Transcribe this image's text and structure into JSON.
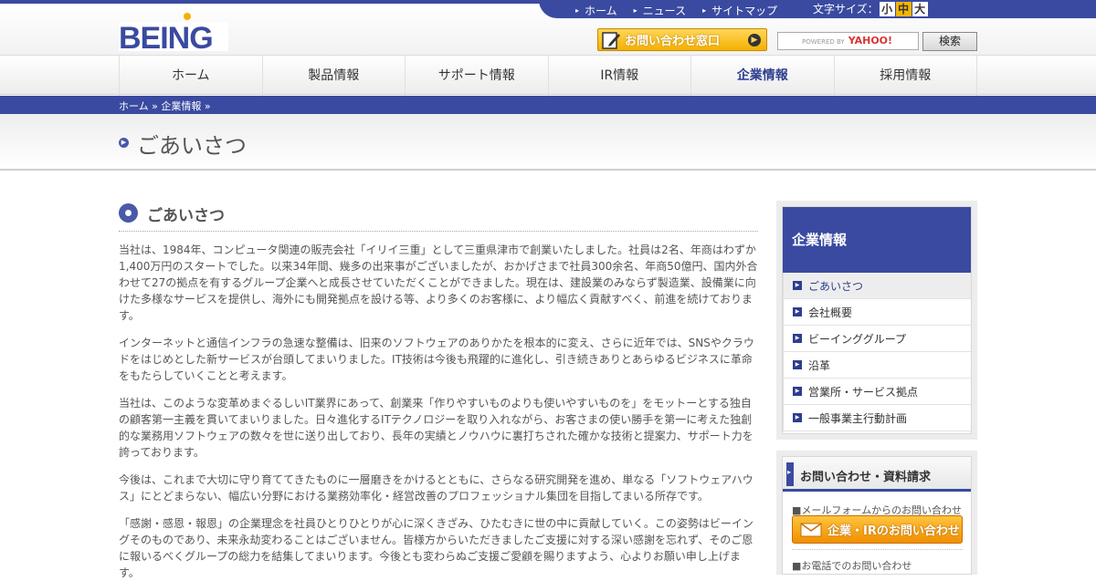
{
  "brand": {
    "logo_text": "BEING"
  },
  "utility": {
    "links": [
      "ホーム",
      "ニュース",
      "サイトマップ"
    ],
    "font_size_label": "文字サイズ：",
    "font_sizes": [
      "小",
      "中",
      "大"
    ],
    "font_size_selected": "中"
  },
  "header": {
    "contact_button": "お問い合わせ窓口",
    "search_powered": "POWERED BY",
    "search_yahoo": "YAHOO!",
    "search_button": "検索"
  },
  "gnav": {
    "items": [
      "ホーム",
      "製品情報",
      "サポート情報",
      "IR情報",
      "企業情報",
      "採用情報"
    ],
    "active": "企業情報"
  },
  "breadcrumb": "ホーム » 企業情報 »",
  "page_title": "ごあいさつ",
  "main": {
    "section_title": "ごあいさつ",
    "paragraphs": [
      "当社は、1984年、コンピュータ関連の販売会社「イリイ三重」として三重県津市で創業いたしました。社員は2名、年商はわずか1,400万円のスタートでした。以来34年間、幾多の出来事がございましたが、おかげさまで社員300余名、年商50億円、国内外合わせて27の拠点を有するグループ企業へと成長させていただくことができました。現在は、建設業のみならず製造業、設備業に向けた多様なサービスを提供し、海外にも開発拠点を設ける等、より多くのお客様に、より幅広く貢献すべく、前進を続けております。",
      "インターネットと通信インフラの急速な整備は、旧来のソフトウェアのありかたを根本的に変え、さらに近年では、SNSやクラウドをはじめとした新サービスが台頭してまいりました。IT技術は今後も飛躍的に進化し、引き続きありとあらゆるビジネスに革命をもたらしていくことと考えます。",
      "当社は、このような変革めまぐるしいIT業界にあって、創業来「作りやすいものよりも使いやすいものを」をモットーとする独自の顧客第一主義を貫いてまいりました。日々進化するITテクノロジーを取り入れながら、お客さまの使い勝手を第一に考えた独創的な業務用ソフトウェアの数々を世に送り出しており、長年の実績とノウハウに裏打ちされた確かな技術と提案力、サポート力を誇っております。",
      "今後は、これまで大切に守り育ててきたものに一層磨きをかけるとともに、さらなる研究開発を進め、単なる「ソフトウェアハウス」にとどまらない、幅広い分野における業務効率化・経営改善のプロフェッショナル集団を目指してまいる所存です。",
      "「感謝・感恩・報恩」の企業理念を社員ひとりひとりが心に深くきざみ、ひたむきに世の中に貢献していく。この姿勢はビーイングそのものであり、未来永劫変わることはございません。皆様方からいただきましたご支援に対する深い感謝を忘れず、そのご恩に報いるべくグループの総力を結集してまいります。今後とも変わらぬご支援ご愛顧を賜りますよう、心よりお願い申し上げます。"
    ]
  },
  "sidebar": {
    "title": "企業情報",
    "items": [
      "ごあいさつ",
      "会社概要",
      "ビーインググループ",
      "沿革",
      "営業所・サービス拠点",
      "一般事業主行動計画"
    ],
    "active": "ごあいさつ"
  },
  "inquiry": {
    "title": "お問い合わせ・資料請求",
    "mail_label": "■メールフォームからのお問い合わせ",
    "mail_button": "企業・IRのお問い合わせ",
    "tel_label": "■お電話でのお問い合わせ"
  },
  "colors": {
    "brand_blue": "#3a4aa0",
    "accent_orange": "#f5b100"
  }
}
